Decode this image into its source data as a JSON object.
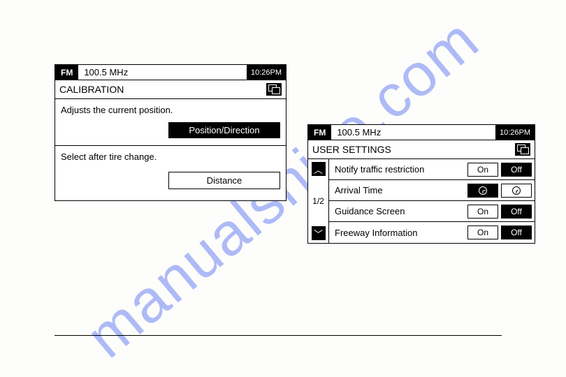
{
  "watermark": "manualshive.com",
  "header": {
    "band": "FM",
    "frequency": "100.5 MHz",
    "time": "10:26PM"
  },
  "calibration": {
    "title": "CALIBRATION",
    "sections": [
      {
        "desc": "Adjusts the current position.",
        "button": "Position/Direction",
        "style": "black"
      },
      {
        "desc": "Select after tire change.",
        "button": "Distance",
        "style": "white"
      }
    ]
  },
  "userSettings": {
    "title": "USER SETTINGS",
    "page": "1/2",
    "rows": [
      {
        "label": "Notify traffic restriction",
        "type": "onoff",
        "on": "On",
        "off": "Off",
        "selected": "Off"
      },
      {
        "label": "Arrival Time",
        "type": "clock",
        "selected": "left"
      },
      {
        "label": "Guidance Screen",
        "type": "onoff",
        "on": "On",
        "off": "Off",
        "selected": "Off"
      },
      {
        "label": "Freeway Information",
        "type": "onoff",
        "on": "On",
        "off": "Off",
        "selected": "Off"
      }
    ]
  }
}
